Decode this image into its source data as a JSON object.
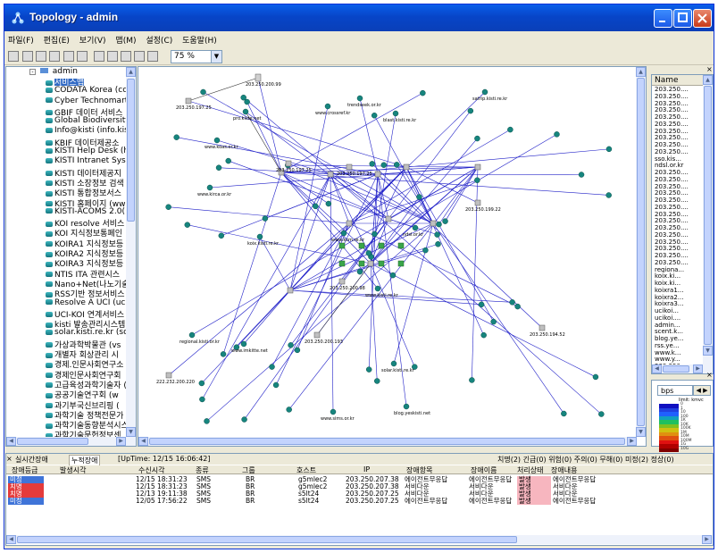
{
  "window": {
    "title": "Topology - admin"
  },
  "menu": [
    "파일(F)",
    "편집(E)",
    "보기(V)",
    "맵(M)",
    "설정(C)",
    "도움말(H)"
  ],
  "toolbar": {
    "zoom": "75 %"
  },
  "tree": {
    "root": "admin",
    "items": [
      "서비스맵",
      "CODATA Korea (cc",
      "Cyber Technomart",
      "GBIF 데이터 서비스",
      "Global Biodiversity",
      "Info@kisti (info.kist",
      "KBIF 데이터제공소",
      "KISTI Help Desk (h",
      "KISTI Intranet Syst",
      "KISTI 데이터제공지",
      "KISTI 소장정보 검색",
      "KISTI 통합정보서스",
      "KISTI 홈페이지 (ww",
      "KISTI-ACOMS 2.0(",
      "KOI resolve 서비스",
      "KOI 지식정보통폐인",
      "KOIRA1 지식정보등",
      "KOIRA2 지식정보등",
      "KOIRA3 지식정보등",
      "NTIS ITA 관련시스",
      "Nano+Net(나노기술",
      "RSS기반 정보서비스",
      "Resolve A UCI (uc",
      "UCI-KOI 연계서비스",
      "kisti 발송관리시스템",
      "solar.kisti.re.kr (so",
      "가상과학박물관 (vs",
      "개별자 회상관리 시",
      "경제.인문사회연구소",
      "경제인문사회연구회",
      "고급육성과학기술자 (",
      "공공기술연구회 (w",
      "과기부국신브리핑 (",
      "과학기술 정책전문가",
      "과학기술동향분석시스",
      "과학기술문헌정보센",
      "과학기술인 공제회",
      "과학기술종합정보서",
      "과학기술포털서비스"
    ]
  },
  "graph": {
    "nodes": [
      {
        "label": "203.250.200.99",
        "kind": "server"
      },
      {
        "label": "203.250.197.25",
        "kind": "router"
      },
      {
        "label": "pro.kiste.net",
        "kind": "host"
      },
      {
        "label": "www.crossref.kr",
        "kind": "host"
      },
      {
        "label": "trendseek.or.kr",
        "kind": "host"
      },
      {
        "label": "satrip.kisti.re.kr",
        "kind": "host"
      },
      {
        "label": "blast.kisti.re.kr",
        "kind": "host"
      },
      {
        "label": "www.koas.or.kr",
        "kind": "host"
      },
      {
        "label": "www.kirca.or.kr",
        "kind": "host"
      },
      {
        "label": "203.250.197.25",
        "kind": "router"
      },
      {
        "label": "203.250.197.25",
        "kind": "router"
      },
      {
        "label": "203.250.199.22",
        "kind": "router"
      },
      {
        "label": "203.250.200.98",
        "kind": "router"
      },
      {
        "label": "www.imkitte.net",
        "kind": "host"
      },
      {
        "label": "blog.yeskisti.net",
        "kind": "host"
      },
      {
        "label": "222.232.200.220",
        "kind": "router"
      },
      {
        "label": "203.250.200.193",
        "kind": "router"
      },
      {
        "label": "www.sims.or.kr",
        "kind": "host"
      },
      {
        "label": "regional.kisti.or.kr",
        "kind": "host"
      },
      {
        "label": "solar.kisti.re.kr",
        "kind": "host"
      },
      {
        "label": "www.kisti.re.kr",
        "kind": "host"
      },
      {
        "label": "www.kcm.re.kr",
        "kind": "host"
      },
      {
        "label": "ndsl.or.kr",
        "kind": "host"
      },
      {
        "label": "koix.kisti.re.kr",
        "kind": "host"
      },
      {
        "label": "203.250.194.52",
        "kind": "router"
      }
    ]
  },
  "name_panel": {
    "header": "Name",
    "rows": [
      "203.250....",
      "203.250....",
      "203.250....",
      "203.250....",
      "203.250....",
      "203.250....",
      "203.250....",
      "203.250....",
      "203.250....",
      "203.250....",
      "sso.kis...",
      "ndsl.or.kr",
      "203.250....",
      "203.250....",
      "203.250....",
      "203.250....",
      "203.250....",
      "203.250....",
      "203.250....",
      "203.250....",
      "203.250....",
      "203.250....",
      "203.250....",
      "203.250....",
      "203.250....",
      "203.250....",
      "regiona...",
      "koix.ki...",
      "koix.ki...",
      "koixra1...",
      "koixra2...",
      "koixra3...",
      "ucikoi...",
      "ucikoi....",
      "admin...",
      "scent.k...",
      "blog.ye...",
      "rss.ye...",
      "www.k...",
      "www.y...",
      "203.250...."
    ]
  },
  "legend": {
    "unit": "bps",
    "caption": "limit: kmvc",
    "ramp_colors": [
      "#1010c0",
      "#2040e0",
      "#2060ff",
      "#10a0c0",
      "#20c060",
      "#80c020",
      "#d0c010",
      "#e09010",
      "#e05010",
      "#e01010",
      "#b00000",
      "#800000"
    ],
    "ramp_labels": [
      "0",
      "1",
      "10",
      "100",
      "1K",
      "10K",
      "100K",
      "1M",
      "10M",
      "100M",
      "1G",
      "10G"
    ]
  },
  "bottom": {
    "tabs": [
      "실시간장애",
      "누적장애"
    ],
    "uptime": "[UpTime: 12/15 16:06:42]",
    "summary": "치명(2) 긴급(0) 위험(0) 주의(0) 무해(0) 미정(2) 정상(0)",
    "columns": [
      "장애등급",
      "발생시각",
      "수신시각",
      "종류",
      "그룹",
      "호스트",
      "IP",
      "장애항목",
      "장애이름",
      "처리상태",
      "장애내용"
    ],
    "rows": [
      {
        "level": "미정",
        "level_color": "#3f74d8",
        "time": "12/15 18:31:23",
        "kind": "SMS",
        "group": "BR",
        "host": "g5mlec2",
        "ip": "203.250.207.38",
        "item": "에이전트무응답",
        "name": "에이전트무응답",
        "status": "발생",
        "content": "에이전트무응답"
      },
      {
        "level": "치명",
        "level_color": "#e43b3b",
        "time": "12/15 18:31:23",
        "kind": "SMS",
        "group": "BR",
        "host": "g5mlec2",
        "ip": "203.250.207.38",
        "item": "서비다운",
        "name": "서비다운",
        "status": "발생",
        "content": "서비다운"
      },
      {
        "level": "치명",
        "level_color": "#e43b3b",
        "time": "12/13 19:11:38",
        "kind": "SMS",
        "group": "BR",
        "host": "s5lt24",
        "ip": "203.250.207.25",
        "item": "서비다운",
        "name": "서비다운",
        "status": "발생",
        "content": "서비다운"
      },
      {
        "level": "미정",
        "level_color": "#3f74d8",
        "time": "12/05 17:56:22",
        "kind": "SMS",
        "group": "BR",
        "host": "s5lt24",
        "ip": "203.250.207.25",
        "item": "에이전트무응답",
        "name": "에이전트무응답",
        "status": "발생",
        "content": "에이전트무응답"
      }
    ]
  }
}
